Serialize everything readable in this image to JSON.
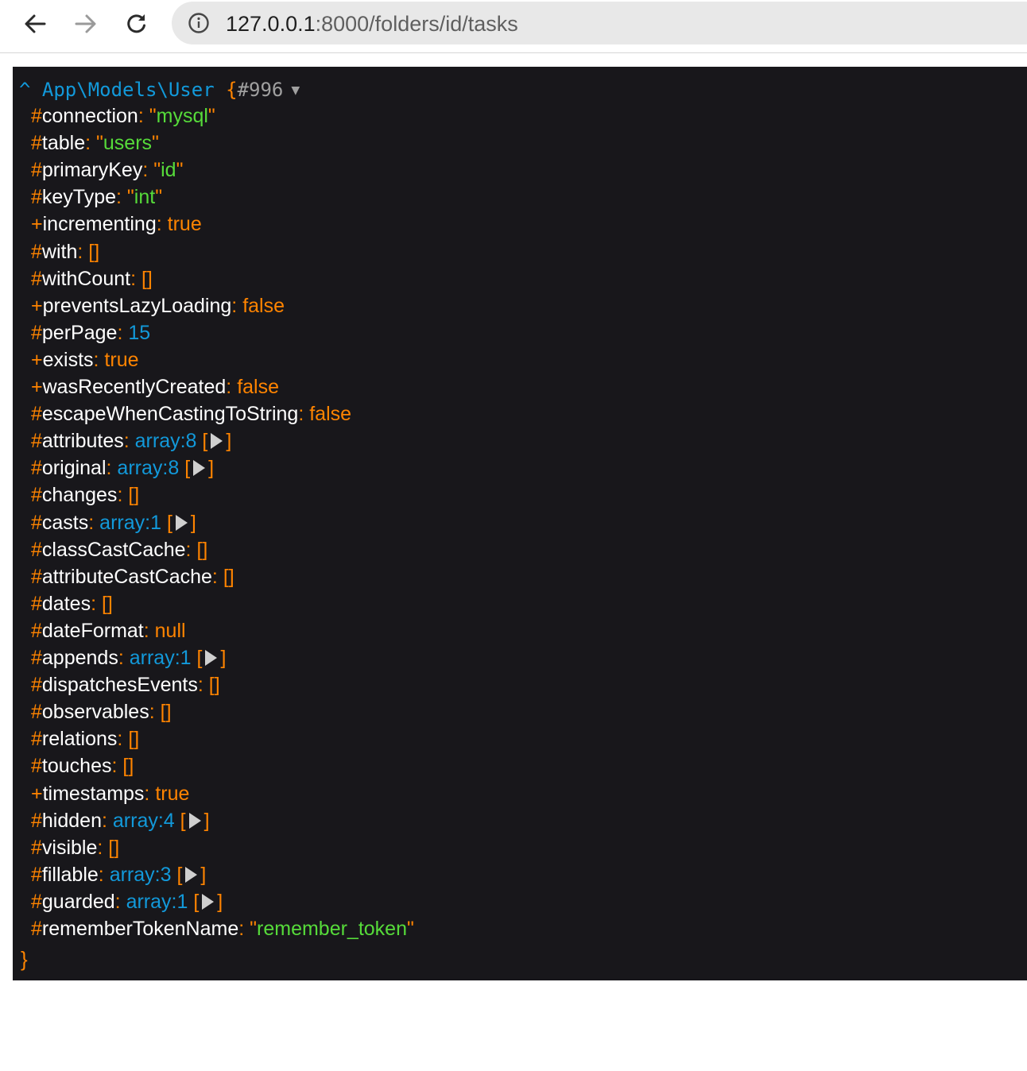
{
  "browser": {
    "url_host": "127.0.0.1",
    "url_rest": ":8000/folders/id/tasks"
  },
  "dump": {
    "caret": "^",
    "class_name": "App\\Models\\User",
    "open_brace": "{",
    "ref": "#996",
    "toggle": "▼",
    "close_brace": "}",
    "properties": [
      {
        "prefix": "#",
        "name": "connection",
        "type": "string",
        "value": "mysql"
      },
      {
        "prefix": "#",
        "name": "table",
        "type": "string",
        "value": "users"
      },
      {
        "prefix": "#",
        "name": "primaryKey",
        "type": "string",
        "value": "id"
      },
      {
        "prefix": "#",
        "name": "keyType",
        "type": "string",
        "value": "int"
      },
      {
        "prefix": "+",
        "name": "incrementing",
        "type": "const",
        "value": "true"
      },
      {
        "prefix": "#",
        "name": "with",
        "type": "empty",
        "value": "[]"
      },
      {
        "prefix": "#",
        "name": "withCount",
        "type": "empty",
        "value": "[]"
      },
      {
        "prefix": "+",
        "name": "preventsLazyLoading",
        "type": "const",
        "value": "false"
      },
      {
        "prefix": "#",
        "name": "perPage",
        "type": "num",
        "value": "15"
      },
      {
        "prefix": "+",
        "name": "exists",
        "type": "const",
        "value": "true"
      },
      {
        "prefix": "+",
        "name": "wasRecentlyCreated",
        "type": "const",
        "value": "false"
      },
      {
        "prefix": "#",
        "name": "escapeWhenCastingToString",
        "type": "const",
        "value": "false"
      },
      {
        "prefix": "#",
        "name": "attributes",
        "type": "array",
        "value": "array:8"
      },
      {
        "prefix": "#",
        "name": "original",
        "type": "array",
        "value": "array:8"
      },
      {
        "prefix": "#",
        "name": "changes",
        "type": "empty",
        "value": "[]"
      },
      {
        "prefix": "#",
        "name": "casts",
        "type": "array",
        "value": "array:1"
      },
      {
        "prefix": "#",
        "name": "classCastCache",
        "type": "empty",
        "value": "[]"
      },
      {
        "prefix": "#",
        "name": "attributeCastCache",
        "type": "empty",
        "value": "[]"
      },
      {
        "prefix": "#",
        "name": "dates",
        "type": "empty",
        "value": "[]"
      },
      {
        "prefix": "#",
        "name": "dateFormat",
        "type": "const",
        "value": "null"
      },
      {
        "prefix": "#",
        "name": "appends",
        "type": "array",
        "value": "array:1"
      },
      {
        "prefix": "#",
        "name": "dispatchesEvents",
        "type": "empty",
        "value": "[]"
      },
      {
        "prefix": "#",
        "name": "observables",
        "type": "empty",
        "value": "[]"
      },
      {
        "prefix": "#",
        "name": "relations",
        "type": "empty",
        "value": "[]"
      },
      {
        "prefix": "#",
        "name": "touches",
        "type": "empty",
        "value": "[]"
      },
      {
        "prefix": "+",
        "name": "timestamps",
        "type": "const",
        "value": "true"
      },
      {
        "prefix": "#",
        "name": "hidden",
        "type": "array",
        "value": "array:4"
      },
      {
        "prefix": "#",
        "name": "visible",
        "type": "empty",
        "value": "[]"
      },
      {
        "prefix": "#",
        "name": "fillable",
        "type": "array",
        "value": "array:3"
      },
      {
        "prefix": "#",
        "name": "guarded",
        "type": "array",
        "value": "array:1"
      },
      {
        "prefix": "#",
        "name": "rememberTokenName",
        "type": "string",
        "value": "remember_token"
      }
    ]
  }
}
